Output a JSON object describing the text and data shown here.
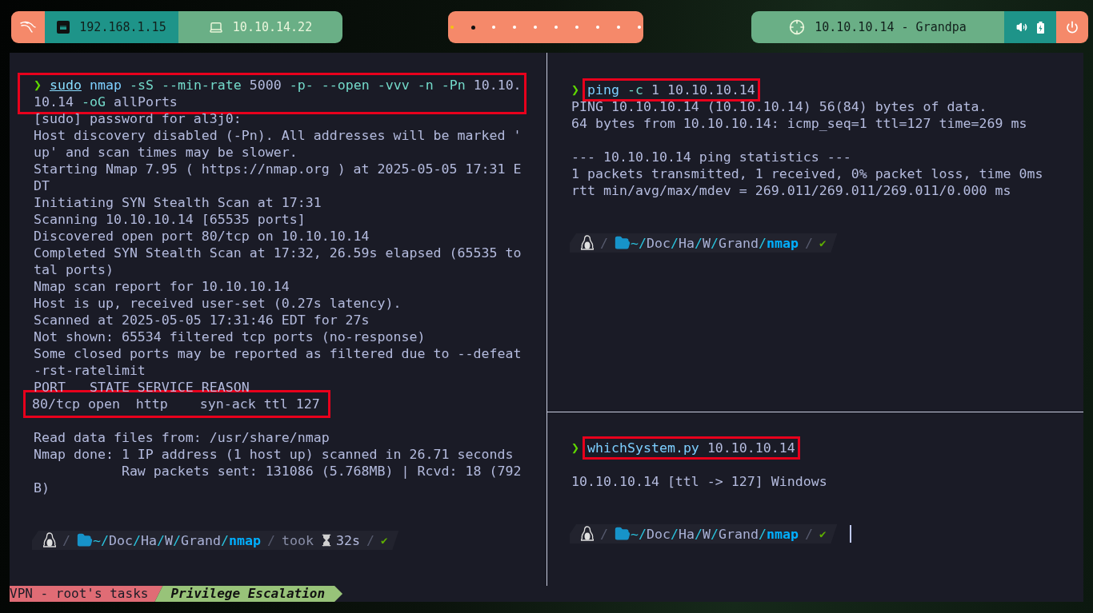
{
  "top_bar": {
    "left": [
      {
        "kind": "ethernet",
        "label": "192.168.1.15"
      },
      {
        "kind": "vpn",
        "label": "10.10.14.22"
      }
    ],
    "workspaces": [
      {
        "selected": true,
        "occupied": false
      },
      {
        "selected": false,
        "occupied": true
      },
      {
        "selected": false,
        "occupied": false
      },
      {
        "selected": false,
        "occupied": false
      },
      {
        "selected": false,
        "occupied": false
      },
      {
        "selected": false,
        "occupied": false
      },
      {
        "selected": false,
        "occupied": false
      },
      {
        "selected": false,
        "occupied": false
      },
      {
        "selected": false,
        "occupied": false
      },
      {
        "selected": false,
        "occupied": false
      }
    ],
    "target": "10.10.10.14 - Grandpa"
  },
  "panes": [
    {
      "command": {
        "prompt": "❯",
        "highlighted": true,
        "box_includes_prompt": true,
        "gap_after": false,
        "lines": [
          [
            {
              "text": "sudo",
              "kind": "sudo"
            },
            {
              "text": "nmap",
              "kind": "program"
            },
            {
              "text": "-sS",
              "kind": "flag"
            },
            {
              "text": "--min-rate",
              "kind": "flag"
            },
            {
              "text": "5000",
              "kind": "arg"
            },
            {
              "text": "-p-",
              "kind": "flag"
            },
            {
              "text": "--open",
              "kind": "flag"
            },
            {
              "text": "-vvv",
              "kind": "flag"
            },
            {
              "text": "-n",
              "kind": "flag"
            },
            {
              "text": "-Pn",
              "kind": "flag"
            },
            {
              "text": "10.10.",
              "kind": "arg"
            }
          ],
          [
            {
              "text": "10.14",
              "kind": "arg"
            },
            {
              "text": "-oG",
              "kind": "flag"
            },
            {
              "text": "allPorts",
              "kind": "arg"
            }
          ]
        ]
      },
      "output": [
        {
          "lines": [
            {
              "text": "[sudo] password for al3j0:",
              "highlighted": false
            },
            {
              "text": "Host discovery disabled (-Pn). All addresses will be marked '",
              "highlighted": false
            },
            {
              "text": "up' and scan times may be slower.",
              "highlighted": false
            },
            {
              "text": "Starting Nmap 7.95 ( https://nmap.org ) at 2025-05-05 17:31 E",
              "highlighted": false
            },
            {
              "text": "DT",
              "highlighted": false
            },
            {
              "text": "Initiating SYN Stealth Scan at 17:31",
              "highlighted": false
            },
            {
              "text": "Scanning 10.10.10.14 [65535 ports]",
              "highlighted": false
            },
            {
              "text": "Discovered open port 80/tcp on 10.10.10.14",
              "highlighted": false
            },
            {
              "text": "Completed SYN Stealth Scan at 17:32, 26.59s elapsed (65535 to",
              "highlighted": false
            },
            {
              "text": "tal ports)",
              "highlighted": false
            },
            {
              "text": "Nmap scan report for 10.10.10.14",
              "highlighted": false
            },
            {
              "text": "Host is up, received user-set (0.27s latency).",
              "highlighted": false
            },
            {
              "text": "Scanned at 2025-05-05 17:31:46 EDT for 27s",
              "highlighted": false
            },
            {
              "text": "Not shown: 65534 filtered tcp ports (no-response)",
              "highlighted": false
            },
            {
              "text": "Some closed ports may be reported as filtered due to --defeat",
              "highlighted": false
            },
            {
              "text": "-rst-ratelimit",
              "highlighted": false
            },
            {
              "text": "PORT   STATE SERVICE REASON",
              "highlighted": false
            },
            {
              "text": "80/tcp open  http    syn-ack ttl 127",
              "highlighted": true
            }
          ]
        },
        {
          "lines": [
            {
              "text": "Read data files from: /usr/share/nmap",
              "highlighted": false
            },
            {
              "text": "Nmap done: 1 IP address (1 host up) scanned in 26.71 seconds",
              "highlighted": false
            },
            {
              "text": "           Raw packets sent: 131086 (5.768MB) | Rcvd: 18 (792",
              "highlighted": false
            },
            {
              "text": "B)",
              "highlighted": false
            }
          ]
        }
      ],
      "prompt": {
        "separator": "/",
        "path": "~/Doc/Ha/W/Grand/",
        "dir": "nmap",
        "took": {
          "label": "took",
          "duration": "32s"
        },
        "status": "✔",
        "cursor": false
      }
    },
    {
      "command": {
        "prompt": "❯",
        "highlighted": true,
        "box_includes_prompt": false,
        "gap_after": false,
        "lines": [
          [
            {
              "text": "ping",
              "kind": "program"
            },
            {
              "text": "-c",
              "kind": "flag"
            },
            {
              "text": "1",
              "kind": "arg"
            },
            {
              "text": "10.10.10.14",
              "kind": "arg"
            }
          ]
        ]
      },
      "output": [
        {
          "lines": [
            {
              "text": "PING 10.10.10.14 (10.10.10.14) 56(84) bytes of data.",
              "highlighted": false
            },
            {
              "text": "64 bytes from 10.10.10.14: icmp_seq=1 ttl=127 time=269 ms",
              "highlighted": false
            }
          ]
        },
        {
          "lines": [
            {
              "text": "--- 10.10.10.14 ping statistics ---",
              "highlighted": false
            },
            {
              "text": "1 packets transmitted, 1 received, 0% packet loss, time 0ms",
              "highlighted": false
            },
            {
              "text": "rtt min/avg/max/mdev = 269.011/269.011/269.011/0.000 ms",
              "highlighted": false
            }
          ]
        }
      ],
      "prompt": {
        "separator": "/",
        "path": "~/Doc/Ha/W/Grand/",
        "dir": "nmap",
        "status": "✔",
        "cursor": false
      }
    },
    {
      "command": {
        "prompt": "❯",
        "highlighted": true,
        "box_includes_prompt": false,
        "gap_after": true,
        "lines": [
          [
            {
              "text": "whichSystem.py",
              "kind": "program"
            },
            {
              "text": "10.10.10.14",
              "kind": "arg"
            }
          ]
        ]
      },
      "output": [
        {
          "lines": [
            {
              "text": "10.10.10.14 [ttl -> 127] Windows",
              "highlighted": false
            }
          ]
        }
      ],
      "prompt": {
        "separator": "/",
        "path": "~/Doc/Ha/W/Grand/",
        "dir": "nmap",
        "status": "✔",
        "cursor": true
      }
    }
  ],
  "status_bar": {
    "session": "VPN - root's tasks",
    "window": "Privilege Escalation"
  }
}
